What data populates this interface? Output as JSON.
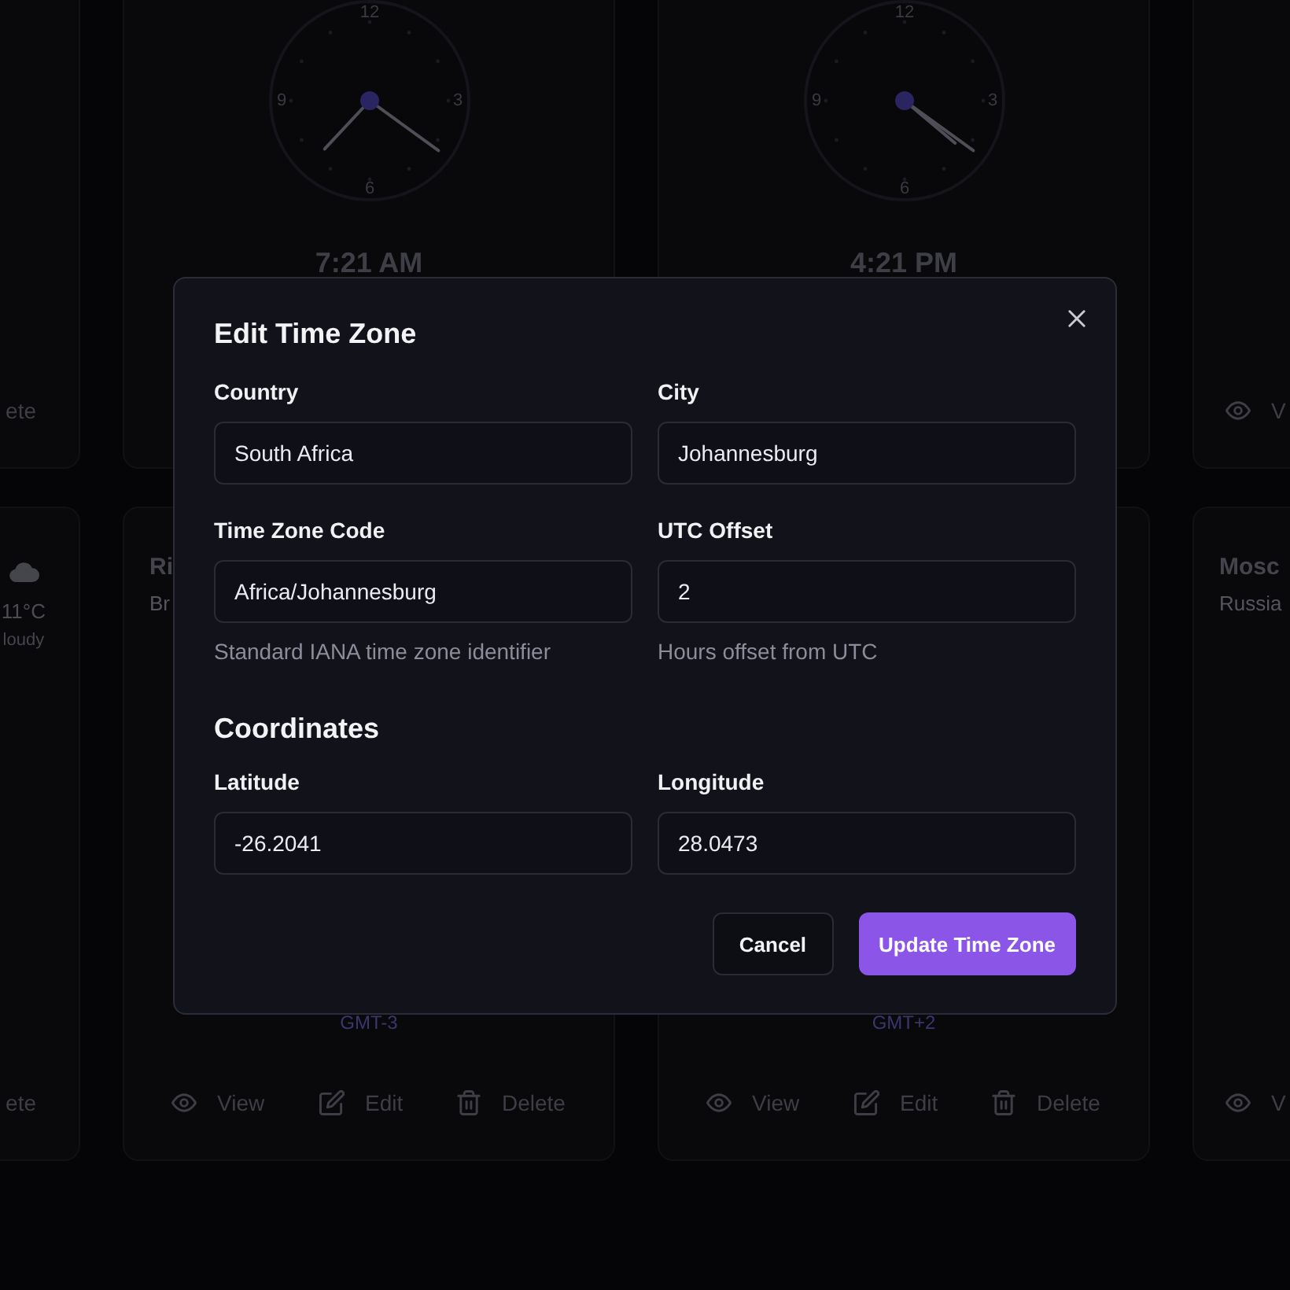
{
  "card_rows": [
    {
      "cards": [
        {
          "kind": "cut_left",
          "actions": [
            {
              "kind": "delete",
              "label": "ete"
            }
          ]
        },
        {
          "kind": "full",
          "clock": {
            "numerals": [
              "12",
              "3",
              "6",
              "9"
            ]
          },
          "time": "7:21 AM"
        },
        {
          "kind": "full",
          "clock": {
            "numerals": [
              "12",
              "3",
              "6",
              "9"
            ]
          },
          "time": "4:21 PM"
        },
        {
          "kind": "cut_right",
          "actions": [
            {
              "kind": "view",
              "label": "V"
            }
          ]
        }
      ]
    },
    {
      "cards": [
        {
          "kind": "cut_left",
          "weather": {
            "temperature": "11°C",
            "condition": "loudy"
          },
          "actions": [
            {
              "kind": "delete",
              "label": "ete"
            }
          ]
        },
        {
          "kind": "full",
          "city": "Ri",
          "country": "Br",
          "offset": "GMT-3",
          "actions": [
            {
              "kind": "view",
              "label": "View"
            },
            {
              "kind": "edit",
              "label": "Edit"
            },
            {
              "kind": "delete",
              "label": "Delete"
            }
          ]
        },
        {
          "kind": "full",
          "offset": "GMT+2",
          "actions": [
            {
              "kind": "view",
              "label": "View"
            },
            {
              "kind": "edit",
              "label": "Edit"
            },
            {
              "kind": "delete",
              "label": "Delete"
            }
          ]
        },
        {
          "kind": "cut_right",
          "city": "Mosc",
          "country": "Russia",
          "actions": [
            {
              "kind": "view",
              "label": "V"
            }
          ]
        }
      ]
    }
  ],
  "dialog": {
    "title": "Edit Time Zone",
    "fields": [
      {
        "label": "Country",
        "value": "South Africa"
      },
      {
        "label": "City",
        "value": "Johannesburg"
      },
      {
        "label": "Time Zone Code",
        "value": "Africa/Johannesburg",
        "help": "Standard IANA time zone identifier"
      },
      {
        "label": "UTC Offset",
        "value": "2",
        "help": "Hours offset from UTC"
      }
    ],
    "sections": [
      {
        "title": "Coordinates",
        "fields": [
          {
            "label": "Latitude",
            "value": "-26.2041"
          },
          {
            "label": "Longitude",
            "value": "28.0473"
          }
        ]
      }
    ],
    "buttons": [
      {
        "kind": "secondary",
        "label": "Cancel"
      },
      {
        "kind": "primary",
        "label": "Update Time Zone"
      }
    ]
  }
}
